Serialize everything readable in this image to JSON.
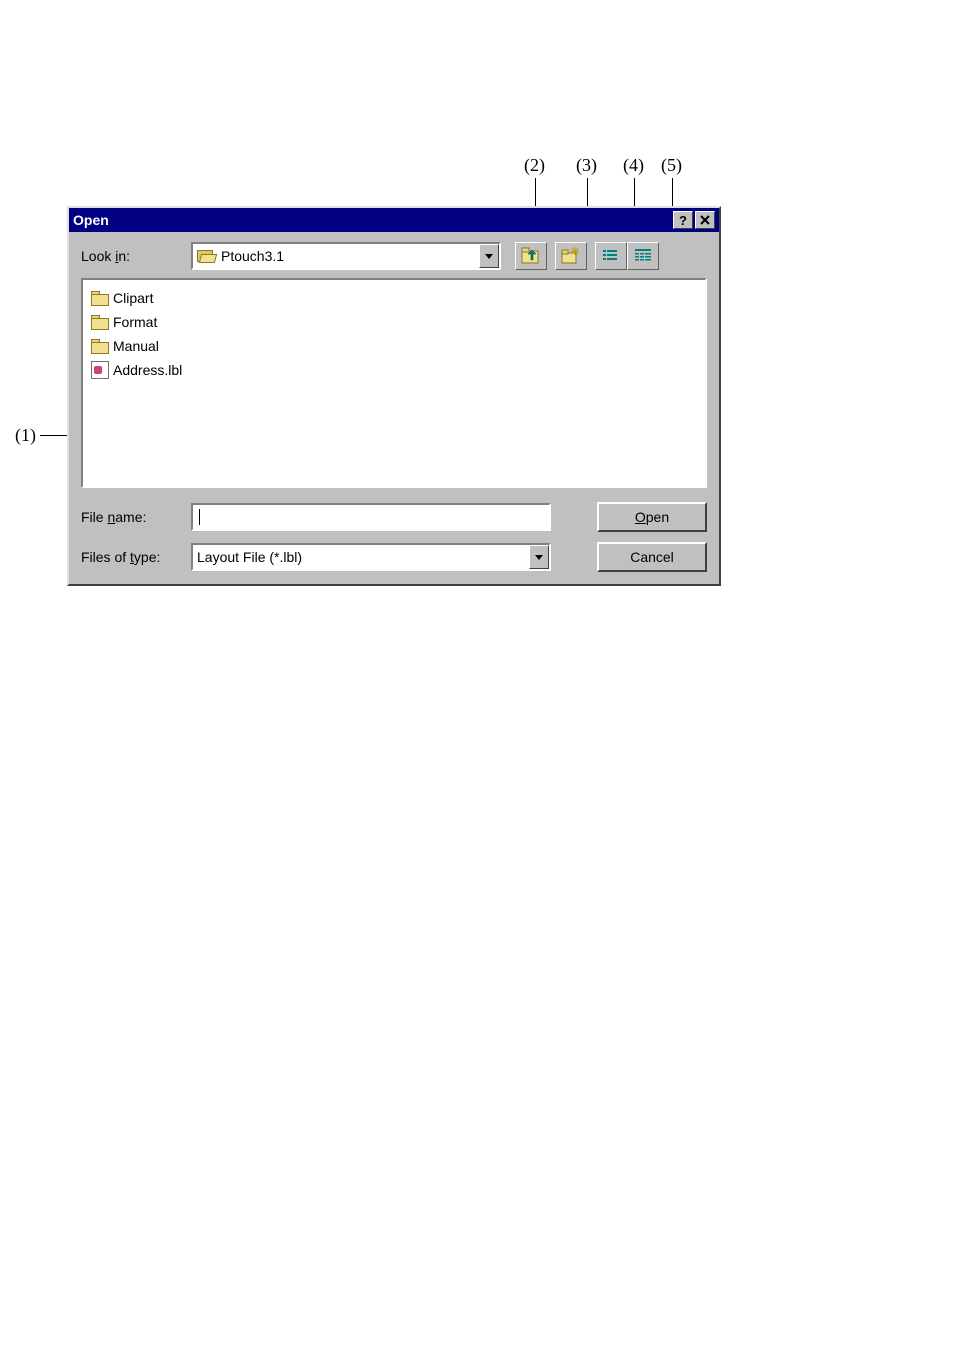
{
  "annotations": {
    "a1": "(1)",
    "a2": "(2)",
    "a3": "(3)",
    "a4": "(4)",
    "a5": "(5)"
  },
  "dialog": {
    "title": "Open",
    "lookin_label_pre": "Look ",
    "lookin_label_u": "i",
    "lookin_label_post": "n:",
    "lookin_value": "Ptouch3.1",
    "filename_label_pre": "File ",
    "filename_label_u": "n",
    "filename_label_post": "ame:",
    "filename_value": "",
    "filetype_label_pre": "Files of ",
    "filetype_label_u": "t",
    "filetype_label_post": "ype:",
    "filetype_value": "Layout File (*.lbl)",
    "open_button_u": "O",
    "open_button_rest": "pen",
    "cancel_button": "Cancel",
    "files": [
      {
        "name": "Clipart",
        "type": "folder"
      },
      {
        "name": "Format",
        "type": "folder"
      },
      {
        "name": "Manual",
        "type": "folder"
      },
      {
        "name": "Address.lbl",
        "type": "file"
      }
    ]
  }
}
